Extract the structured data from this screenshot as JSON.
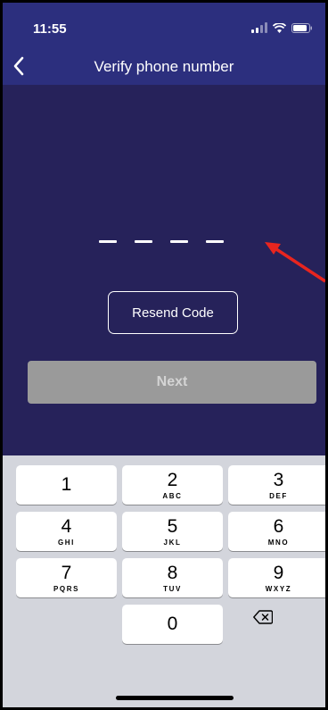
{
  "status_bar": {
    "time": "11:55",
    "signal_icon": "signal-icon",
    "wifi_icon": "wifi-icon",
    "battery_icon": "battery-icon"
  },
  "nav": {
    "title": "Verify phone number",
    "back_icon": "chevron-left-icon"
  },
  "verification": {
    "code_length": 4,
    "entered_code": "",
    "resend_label": "Resend Code",
    "next_label": "Next",
    "next_enabled": false
  },
  "keypad": {
    "keys": [
      {
        "digit": "1",
        "letters": ""
      },
      {
        "digit": "2",
        "letters": "ABC"
      },
      {
        "digit": "3",
        "letters": "DEF"
      },
      {
        "digit": "4",
        "letters": "GHI"
      },
      {
        "digit": "5",
        "letters": "JKL"
      },
      {
        "digit": "6",
        "letters": "MNO"
      },
      {
        "digit": "7",
        "letters": "PQRS"
      },
      {
        "digit": "8",
        "letters": "TUV"
      },
      {
        "digit": "9",
        "letters": "WXYZ"
      },
      {
        "digit": "0",
        "letters": ""
      }
    ],
    "delete_icon": "backspace-icon"
  },
  "colors": {
    "background": "#26225a",
    "bar": "#2c2f7e",
    "next_disabled": "#9a9a9a",
    "annotation_arrow": "#e8251f",
    "keyboard": "#d3d5dc"
  }
}
